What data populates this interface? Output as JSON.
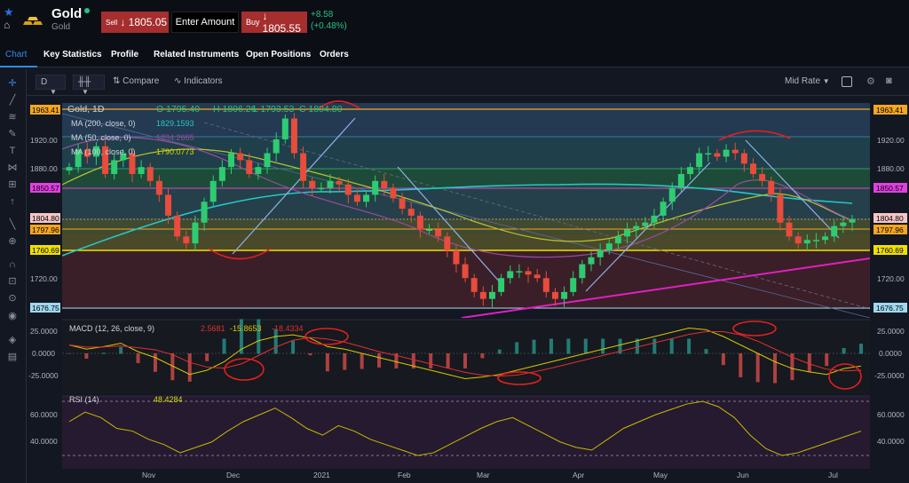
{
  "header": {
    "title": "Gold",
    "subtitle": "Gold",
    "sell_label": "Sell",
    "sell_price": "↓ 1805.05",
    "amount_placeholder": "Enter Amount",
    "buy_label": "Buy",
    "buy_price": "↓ 1805.55",
    "change_abs": "+8.58",
    "change_pct": "(+0.48%)",
    "status_color": "#26c281"
  },
  "tabs": [
    {
      "label": "Chart",
      "active": true
    },
    {
      "label": "Key Statistics"
    },
    {
      "label": "Profile"
    },
    {
      "label": "Related Instruments"
    },
    {
      "label": "Open Positions"
    },
    {
      "label": "Orders"
    }
  ],
  "toolbar": {
    "interval": "D",
    "compare_label": "Compare",
    "indicators_label": "Indicators",
    "price_type": "Mid Rate"
  },
  "left_tools": [
    "crosshair-icon",
    "trendline-icon",
    "fib-icon",
    "brush-icon",
    "text-icon",
    "pattern-icon",
    "measure-icon",
    "zoom-icon",
    "arrow-icon",
    "ruler-icon",
    "zoom-in-icon",
    "magnet-icon",
    "lock-icon",
    "visibility-icon",
    "layers-icon",
    "trash-icon"
  ],
  "legend": {
    "symbol_line": "Gold, 1D",
    "open": "O 1795.40",
    "high": "H 1806.26",
    "low": "L 1793.53",
    "close": "C 1804.80",
    "ma200_label": "MA (200, close, 0)",
    "ma200_value": "1829.1593",
    "ma50_label": "MA (50, close, 0)",
    "ma50_value": "1834.2665",
    "ma100_label": "MA (100, close, 0)",
    "ma100_value": "1790.0773",
    "macd_label": "MACD (12, 26, close, 9)",
    "macd_hist": "2.5681",
    "macd_value": "-15.8653",
    "macd_signal": "-18.4334",
    "rsi_label": "RSI (14)",
    "rsi_value": "48.4284"
  },
  "price_axis": {
    "ticks": [
      "1920.00",
      "1880.00",
      "1720.00"
    ],
    "markers": [
      {
        "label": "1963.41",
        "color": "#f5a623"
      },
      {
        "label": "1850.57",
        "color": "#e040e0"
      },
      {
        "label": "1804.80",
        "color": "#f5a6a6"
      },
      {
        "label": "1797.96",
        "color": "#f5a623"
      },
      {
        "label": "1760.69",
        "color": "#f0e000"
      },
      {
        "label": "1676.75",
        "color": "#a0d8f0"
      }
    ]
  },
  "macd_axis": {
    "ticks": [
      "25.0000",
      "0.0000",
      "-25.0000"
    ]
  },
  "rsi_axis": {
    "ticks": [
      "60.0000",
      "40.0000"
    ]
  },
  "time_axis": [
    "Nov",
    "Dec",
    "2021",
    "Feb",
    "Mar",
    "Apr",
    "May",
    "Jun",
    "Jul"
  ],
  "chart_data": {
    "type": "candlestick",
    "series_name": "Gold, 1D",
    "y_range": [
      1676.75,
      1963.41
    ],
    "levels": [
      1963.41,
      1920.0,
      1880.0,
      1850.57,
      1804.8,
      1797.96,
      1760.69,
      1676.75
    ],
    "close_path": [
      1880,
      1905,
      1895,
      1910,
      1870,
      1890,
      1900,
      1870,
      1880,
      1860,
      1840,
      1810,
      1780,
      1770,
      1800,
      1830,
      1860,
      1880,
      1900,
      1890,
      1870,
      1880,
      1900,
      1920,
      1950,
      1900,
      1860,
      1850,
      1850,
      1860,
      1855,
      1840,
      1830,
      1840,
      1860,
      1850,
      1835,
      1820,
      1810,
      1790,
      1790,
      1780,
      1760,
      1740,
      1720,
      1700,
      1690,
      1700,
      1720,
      1730,
      1730,
      1725,
      1720,
      1700,
      1690,
      1700,
      1720,
      1740,
      1750,
      1760,
      1770,
      1780,
      1790,
      1795,
      1800,
      1810,
      1830,
      1850,
      1870,
      1880,
      1900,
      1900,
      1895,
      1905,
      1900,
      1885,
      1870,
      1860,
      1840,
      1800,
      1780,
      1770,
      1775,
      1775,
      1780,
      1795,
      1800,
      1805
    ],
    "macd": [
      10,
      5,
      8,
      12,
      2,
      -5,
      -15,
      -25,
      -20,
      -10,
      5,
      15,
      20,
      22,
      18,
      8,
      5,
      0,
      -5,
      -10,
      -15,
      -20,
      -25,
      -30,
      -28,
      -25,
      -20,
      -15,
      -10,
      -5,
      0,
      5,
      10,
      15,
      20,
      25,
      30,
      28,
      20,
      10,
      0,
      -10,
      -18,
      -22,
      -25,
      -18,
      -15
    ],
    "rsi": [
      55,
      62,
      58,
      50,
      48,
      42,
      38,
      32,
      36,
      40,
      48,
      55,
      60,
      65,
      58,
      50,
      45,
      52,
      48,
      42,
      38,
      34,
      30,
      32,
      38,
      44,
      50,
      55,
      58,
      52,
      46,
      40,
      36,
      34,
      42,
      50,
      55,
      60,
      64,
      68,
      70,
      66,
      58,
      45,
      35,
      30,
      32,
      36,
      40,
      44,
      48
    ]
  }
}
